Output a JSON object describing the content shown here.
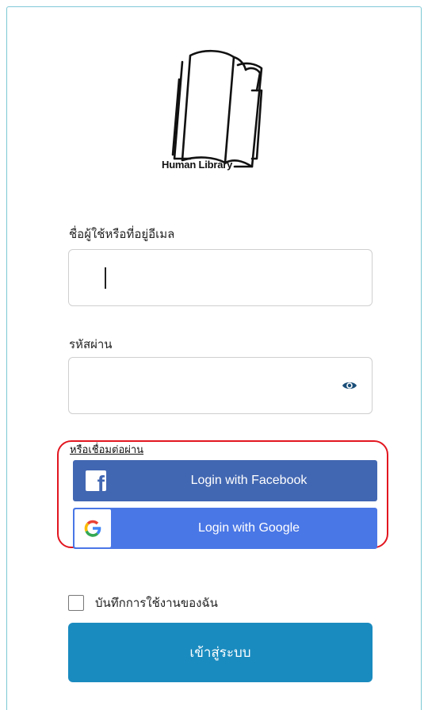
{
  "logo": {
    "text": "Human Library"
  },
  "username": {
    "label": "ชื่อผู้ใช้หรือที่อยู่อีเมล",
    "value": ""
  },
  "password": {
    "label": "รหัสผ่าน",
    "value": "",
    "toggle_icon": "eye-icon"
  },
  "social": {
    "caption": "หรือเชื่อมต่อผ่าน",
    "facebook_label": "Login with Facebook",
    "google_label": "Login with Google"
  },
  "remember": {
    "label": "บันทึกการใช้งานของฉัน",
    "checked": false
  },
  "submit": {
    "label": "เข้าสู่ระบบ"
  },
  "colors": {
    "facebook": "#4267b2",
    "google": "#4a77e6",
    "primary": "#1a8bbf",
    "highlight": "#e2161f",
    "card_border": "#7ec8d6"
  }
}
